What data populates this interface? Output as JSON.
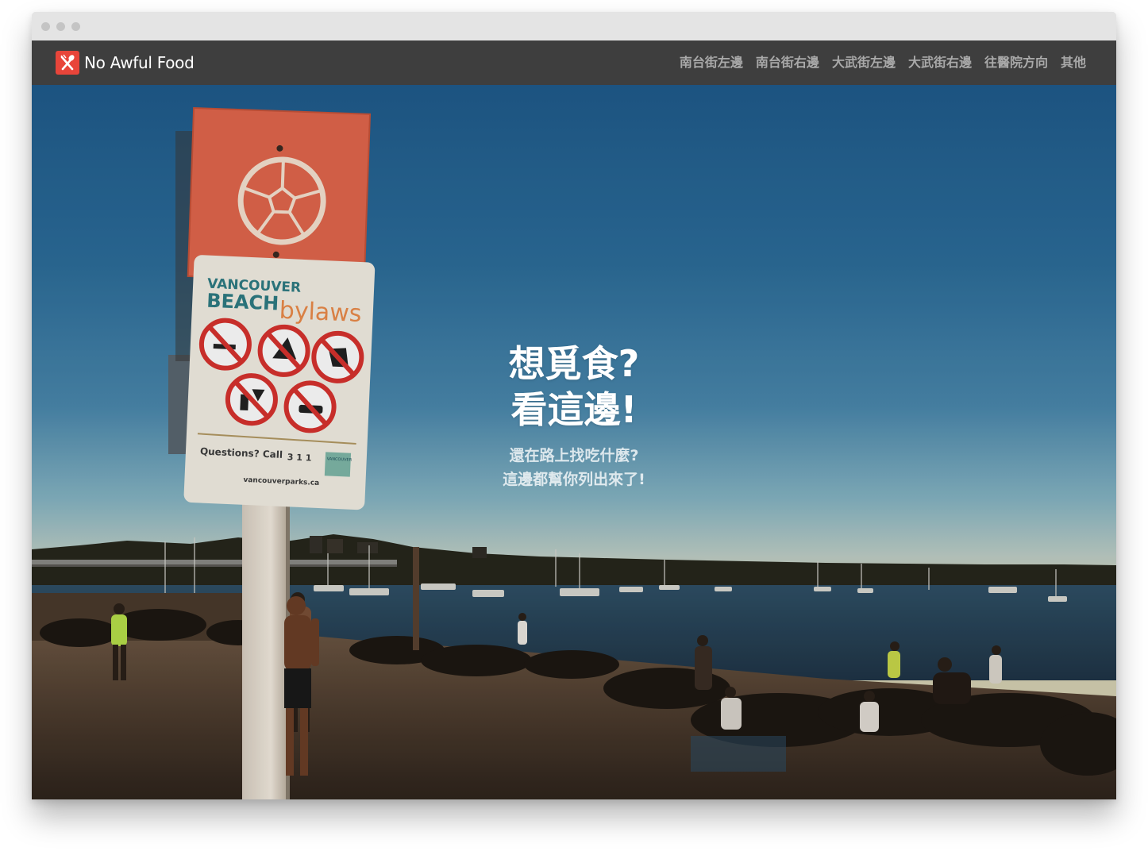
{
  "brand": {
    "name": "No Awful Food",
    "logo_icon": "fork-knife-icon",
    "logo_color": "#e8453a"
  },
  "nav": {
    "items": [
      {
        "label": "南台街左邊"
      },
      {
        "label": "南台街右邊"
      },
      {
        "label": "大武街左邊"
      },
      {
        "label": "大武街右邊"
      },
      {
        "label": "往醫院方向"
      },
      {
        "label": "其他"
      }
    ]
  },
  "hero": {
    "headline_line1": "想覓食?",
    "headline_line2": "看這邊!",
    "subline_line1": "還在路上找吃什麼?",
    "subline_line2": "這邊都幫你列出來了!",
    "background": "beach-photo",
    "sign": {
      "title_line1": "VANCOUVER",
      "title_line2": "BEACH",
      "title_suffix": "bylaws",
      "questions": "Questions?  Call",
      "call_digits": "3 1 1",
      "website": "vancouverparks.ca",
      "board_logo": "VANCOUVER"
    }
  },
  "colors": {
    "navbar": "#3e3e3e",
    "nav_text": "#a9a9a9",
    "sign_orange": "#e2674c",
    "prohibition_red": "#d8322e"
  }
}
